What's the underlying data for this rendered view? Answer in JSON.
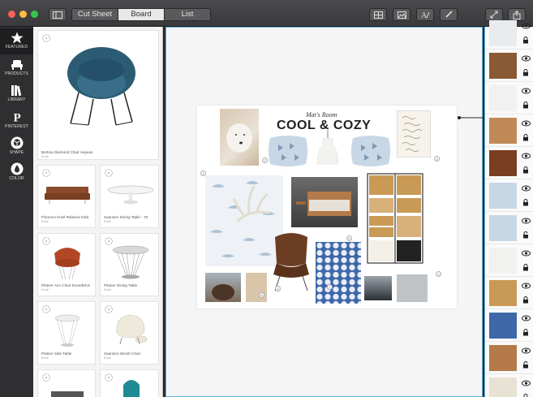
{
  "toolbar": {
    "tabs": [
      {
        "label": "Cut Sheet",
        "active": false
      },
      {
        "label": "Board",
        "active": true
      },
      {
        "label": "List",
        "active": false
      }
    ]
  },
  "sidebar": {
    "items": [
      {
        "label": "FEATURED",
        "icon": "star-icon",
        "active": true
      },
      {
        "label": "PRODUCTS",
        "icon": "chair-icon",
        "active": false
      },
      {
        "label": "LIBRARY",
        "icon": "books-icon",
        "active": false
      },
      {
        "label": "PINTEREST",
        "icon": "pinterest-icon",
        "active": false
      },
      {
        "label": "SHAPE",
        "icon": "cube-icon",
        "active": false
      },
      {
        "label": "COLOR",
        "icon": "drop-icon",
        "active": false
      }
    ]
  },
  "library": {
    "featured": {
      "name": "Bertoia Diamond Chair Aegean",
      "brand": "Knoll"
    },
    "products": [
      {
        "name": "Florence Knoll Relaxed Sofa",
        "brand": "Knoll"
      },
      {
        "name": "Saarinen Dining Table - 78",
        "brand": "Knoll"
      },
      {
        "name": "Platner Arm Chair Dove/Brick",
        "brand": "Knoll"
      },
      {
        "name": "Platner Dining Table",
        "brand": "Knoll"
      },
      {
        "name": "Platner Side Table",
        "brand": "Knoll"
      },
      {
        "name": "Saarinen Womb Chair",
        "brand": "Knoll"
      }
    ]
  },
  "board": {
    "subtitle": "Mat's Room",
    "title": "COOL & COZY",
    "hotspots": [
      "1",
      "2",
      "3",
      "4",
      "5",
      "6",
      "7",
      "8"
    ]
  },
  "colors": {
    "accent": "#5fb3d9",
    "chair_blue": "#2c5c74",
    "chair_brown": "#6b3e23",
    "wood": "#c99a55"
  }
}
